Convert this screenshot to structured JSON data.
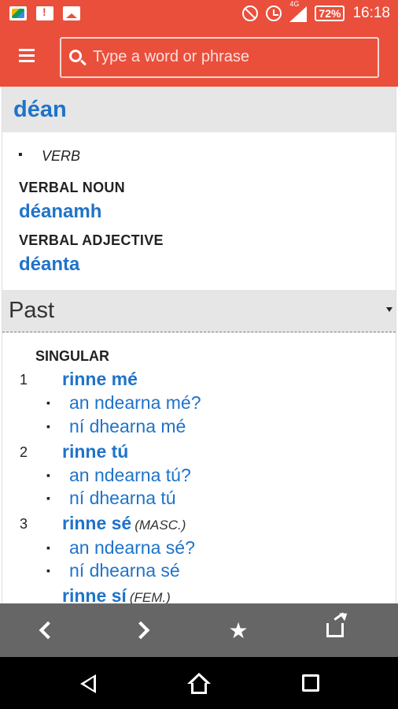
{
  "status_bar": {
    "battery": "72%",
    "network": "4G",
    "time": "16:18"
  },
  "search": {
    "placeholder": "Type a word or phrase"
  },
  "entry": {
    "headword": "déan",
    "part_of_speech": "VERB",
    "verbal_noun_label": "VERBAL NOUN",
    "verbal_noun": "déanamh",
    "verbal_adjective_label": "VERBAL ADJECTIVE",
    "verbal_adjective": "déanta"
  },
  "tense": {
    "selected": "Past",
    "number_label": "SINGULAR",
    "persons": [
      {
        "num": "1",
        "form": "rinne mé",
        "note": "",
        "variants": [
          "an ndearna mé?",
          "ní dhearna mé"
        ]
      },
      {
        "num": "2",
        "form": "rinne tú",
        "note": "",
        "variants": [
          "an ndearna tú?",
          "ní dhearna tú"
        ]
      },
      {
        "num": "3",
        "form": "rinne sé",
        "note": "(MASC.)",
        "variants": [
          "an ndearna sé?",
          "ní dhearna sé"
        ]
      },
      {
        "num": "",
        "form": "rinne sí",
        "note": "(FEM.)",
        "variants": []
      }
    ]
  },
  "toolbar": {
    "back_icon": "chevron-left-icon",
    "forward_icon": "chevron-right-icon",
    "favorite_icon": "star-icon",
    "share_icon": "share-icon"
  },
  "colors": {
    "accent": "#ea4f3c",
    "link": "#1f73c9",
    "toolbar": "#666666"
  }
}
